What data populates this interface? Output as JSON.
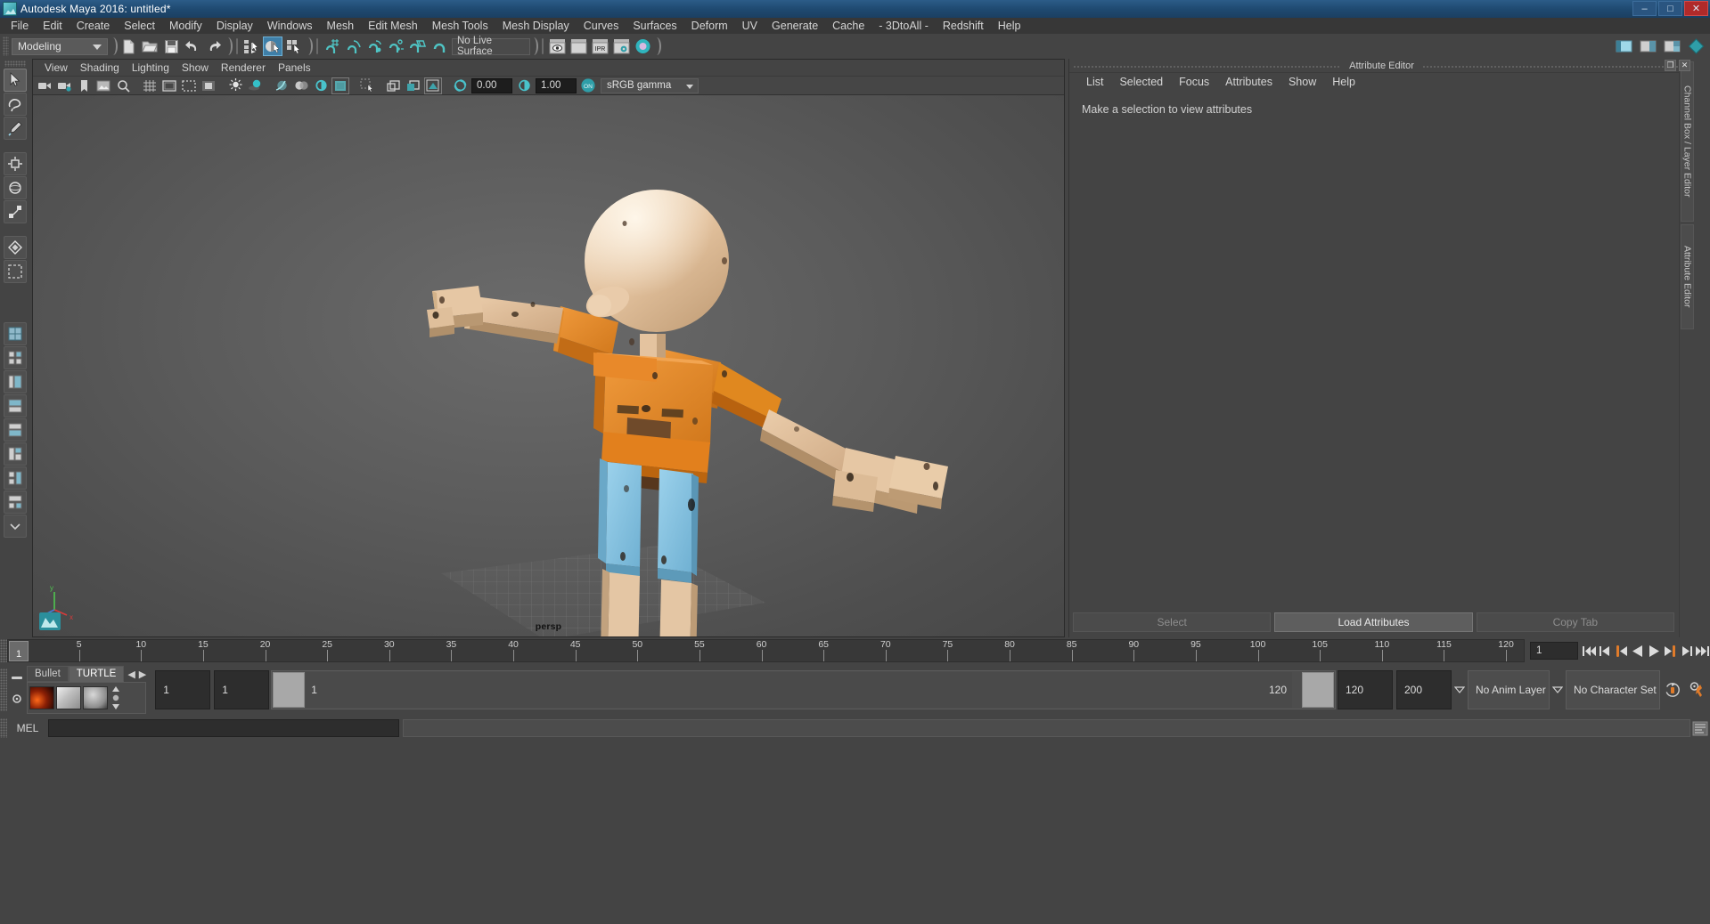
{
  "window": {
    "title": "Autodesk Maya 2016: untitled*",
    "icon": "maya-logo-icon",
    "minimize": "–",
    "maximize": "□",
    "close": "✕"
  },
  "menubar": {
    "items": [
      "File",
      "Edit",
      "Create",
      "Select",
      "Modify",
      "Display",
      "Windows",
      "Mesh",
      "Edit Mesh",
      "Mesh Tools",
      "Mesh Display",
      "Curves",
      "Surfaces",
      "Deform",
      "UV",
      "Generate",
      "Cache",
      "- 3DtoAll -",
      "Redshift",
      "Help"
    ]
  },
  "toolbar": {
    "mode_selector": "Modeling",
    "live_surface": "No Live Surface",
    "file_icons": [
      "new-scene-icon",
      "open-scene-icon",
      "save-scene-icon",
      "undo-icon",
      "redo-icon"
    ],
    "select_mode_icons": [
      "select-by-hierarchy-icon",
      "select-by-object-type-icon",
      "select-by-component-type-icon"
    ],
    "snap_icons": [
      "snap-to-grid-icon",
      "snap-to-curve-icon",
      "snap-to-point-icon",
      "snap-to-projected-center-icon",
      "snap-to-view-plane-icon",
      "make-live-icon"
    ],
    "render_icons": [
      "render-current-frame-icon",
      "render-sequence-icon",
      "ipr-render-icon",
      "render-settings-icon",
      "hypershade-icon"
    ],
    "right_icons": [
      "show-hide-editors-icon",
      "channel-box-toggle-icon",
      "layer-editor-toggle-icon",
      "attribute-editor-toggle-icon"
    ]
  },
  "toolbox": {
    "tools": [
      "select-tool",
      "lasso-select-tool",
      "paint-select-tool",
      "move-tool",
      "rotate-tool",
      "scale-tool",
      "soft-select-tool",
      "last-tool-used"
    ],
    "layouts": [
      "single-perspective-layout",
      "four-view-layout",
      "outliner-persp-layout",
      "persp-graph-layout",
      "hypershade-persp-layout",
      "persp-outliner-hypergraph-layout",
      "two-pane-stacked-layout",
      "three-pane-split-layout",
      "more-layouts"
    ]
  },
  "viewport_panel": {
    "menus": [
      "View",
      "Shading",
      "Lighting",
      "Show",
      "Renderer",
      "Panels"
    ],
    "camera_label": "persp",
    "exposure_value": "0.00",
    "gamma_value": "1.00",
    "color_management": "sRGB gamma",
    "cm_toggle": "ON",
    "toolbar_icons": [
      "select-camera-icon",
      "camera-attributes-icon",
      "bookmarks-icon",
      "image-plane-icon",
      "two-d-pan-zoom-icon",
      "grid-toggle-icon",
      "film-gate-icon",
      "resolution-gate-icon",
      "gate-mask-icon",
      "field-chart-icon",
      "safe-action-icon",
      "safe-title-icon",
      "xray-toggle-icon",
      "xray-joints-icon",
      "lights-toggle-icon",
      "shadows-toggle-icon",
      "ambient-occlusion-icon",
      "motion-blur-icon",
      "multisample-icon",
      "wireframe-shaded-icon",
      "isolate-select-icon",
      "single-texture-icon",
      "hardware-texturing-icon",
      "smooth-shade-icon",
      "exposure-icon",
      "gamma-icon",
      "color-management-toggle-icon"
    ]
  },
  "attribute_editor": {
    "title": "Attribute Editor",
    "menus": [
      "List",
      "Selected",
      "Focus",
      "Attributes",
      "Show",
      "Help"
    ],
    "message": "Make a selection to view attributes",
    "buttons": {
      "select": "Select",
      "load_attributes": "Load Attributes",
      "copy_tab": "Copy Tab"
    },
    "window_buttons": [
      "undock-icon",
      "close-icon"
    ],
    "side_tabs": [
      "Channel Box / Layer Editor",
      "Attribute Editor"
    ]
  },
  "time_slider": {
    "current_frame": "1",
    "frame_field": "1",
    "ticks": [
      5,
      10,
      15,
      20,
      25,
      30,
      35,
      40,
      45,
      50,
      55,
      60,
      65,
      70,
      75,
      80,
      85,
      90,
      95,
      100,
      105,
      110,
      115,
      120
    ],
    "start": 1,
    "end": 120,
    "playback_buttons": [
      "go-to-start-icon",
      "step-back-keyframe-icon",
      "step-back-frame-icon",
      "play-backwards-icon",
      "play-forwards-icon",
      "step-forward-frame-icon",
      "step-forward-keyframe-icon",
      "go-to-end-icon"
    ]
  },
  "range_slider": {
    "anim_start": "1",
    "range_start": "1",
    "range_bar_start_label": "1",
    "range_bar_end_label": "120",
    "range_end": "120",
    "anim_end": "200",
    "anim_layer": "No Anim Layer",
    "character_set": "No Character Set",
    "auto_key_icon": "auto-keyframe-icon",
    "anim_prefs_icon": "animation-preferences-icon"
  },
  "shelf": {
    "tabs": [
      "Bullet",
      "TURTLE"
    ],
    "active_tab": "TURTLE",
    "nav_prev": "◀",
    "nav_next": "▶",
    "icons": [
      "turtle-render-icon",
      "turtle-bake-icon",
      "turtle-material-icon"
    ]
  },
  "command_line": {
    "label": "MEL",
    "input_value": "",
    "result_value": "",
    "script_editor_icon": "script-editor-icon"
  },
  "colors": {
    "accent_blue": "#3f7fa8",
    "titlebar_blue": "#1f4a71",
    "panel_gray": "#444444",
    "viewport_gray": "#5b5b5b",
    "orange": "#e8821e",
    "skin": "#e2bb95",
    "blue_limb": "#7ec0e0",
    "brown": "#6f4a2a",
    "field_dark": "#2d2d2d"
  }
}
